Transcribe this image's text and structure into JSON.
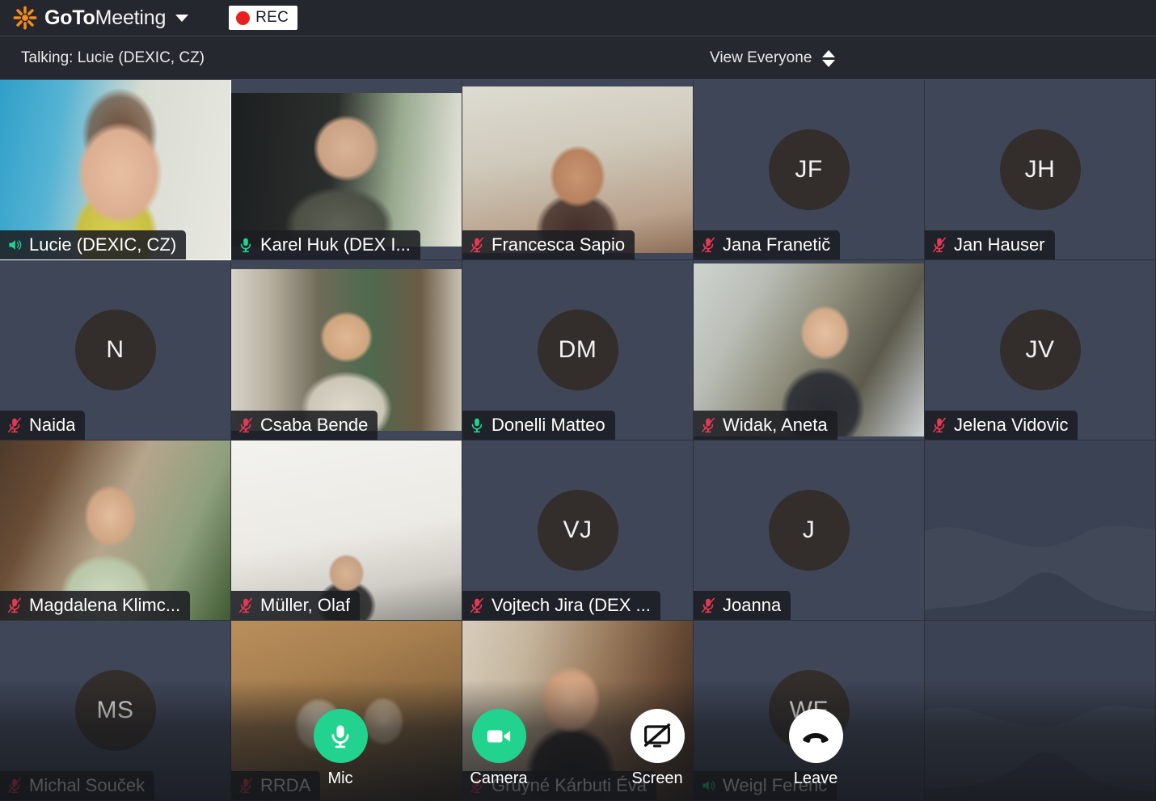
{
  "app": {
    "brand_bold": "GoTo",
    "brand_light": "Meeting",
    "recording_label": "REC"
  },
  "statusbar": {
    "talking": "Talking: Lucie (DEXIC, CZ)",
    "view_mode": "View Everyone"
  },
  "colors": {
    "accent_green": "#22d28f",
    "muted_red": "#e23a54",
    "rec_red": "#e8201f",
    "brand_orange": "#f68b1f",
    "tile_bg": "#3e4658",
    "avatar_bg": "#332e2b",
    "header_bg": "#24272d"
  },
  "participants": [
    {
      "name": "Lucie (DEXIC, CZ)",
      "audio": "speaker",
      "video": true,
      "active": true,
      "initials": "",
      "scene": "lucie"
    },
    {
      "name": "Karel Huk (DEX I...",
      "audio": "unmuted",
      "video": true,
      "active": false,
      "initials": "",
      "scene": "karel"
    },
    {
      "name": "Francesca Sapio",
      "audio": "muted",
      "video": true,
      "active": false,
      "initials": "",
      "scene": "francesca"
    },
    {
      "name": "Jana Franetič",
      "audio": "muted",
      "video": false,
      "active": false,
      "initials": "JF",
      "scene": ""
    },
    {
      "name": "Jan Hauser",
      "audio": "muted",
      "video": false,
      "active": false,
      "initials": "JH",
      "scene": ""
    },
    {
      "name": "Naida",
      "audio": "muted",
      "video": false,
      "active": false,
      "initials": "N",
      "scene": ""
    },
    {
      "name": "Csaba Bende",
      "audio": "muted",
      "video": true,
      "active": false,
      "initials": "",
      "scene": "csaba"
    },
    {
      "name": "Donelli Matteo",
      "audio": "unmuted",
      "video": false,
      "active": false,
      "initials": "DM",
      "scene": ""
    },
    {
      "name": "Widak, Aneta",
      "audio": "muted",
      "video": true,
      "active": false,
      "initials": "",
      "scene": "aneta"
    },
    {
      "name": "Jelena Vidovic",
      "audio": "muted",
      "video": false,
      "active": false,
      "initials": "JV",
      "scene": ""
    },
    {
      "name": "Magdalena Klimc...",
      "audio": "muted",
      "video": true,
      "active": false,
      "initials": "",
      "scene": "magdalena"
    },
    {
      "name": "Müller, Olaf",
      "audio": "muted",
      "video": true,
      "active": false,
      "initials": "",
      "scene": "olaf"
    },
    {
      "name": "Vojtech Jira (DEX ...",
      "audio": "muted",
      "video": false,
      "active": false,
      "initials": "VJ",
      "scene": ""
    },
    {
      "name": "Joanna",
      "audio": "muted",
      "video": false,
      "active": false,
      "initials": "J",
      "scene": ""
    },
    {
      "name": "",
      "audio": "",
      "video": false,
      "active": false,
      "initials": "",
      "scene": "empty"
    },
    {
      "name": "Michal Souček",
      "audio": "muted",
      "video": false,
      "active": false,
      "initials": "MS",
      "scene": ""
    },
    {
      "name": "RRDA",
      "audio": "muted",
      "video": true,
      "active": false,
      "initials": "",
      "scene": "rrda"
    },
    {
      "name": "Gruyné Kárbuti Éva",
      "audio": "muted",
      "video": true,
      "active": false,
      "initials": "",
      "scene": "eva"
    },
    {
      "name": "Weigl Ferenc",
      "audio": "speaker",
      "video": false,
      "active": false,
      "initials": "WF",
      "scene": ""
    },
    {
      "name": "",
      "audio": "",
      "video": false,
      "active": false,
      "initials": "",
      "scene": "empty"
    }
  ],
  "controls": [
    {
      "id": "mic",
      "label": "Mic",
      "style": "green",
      "icon": "microphone-icon"
    },
    {
      "id": "camera",
      "label": "Camera",
      "style": "green",
      "icon": "video-camera-icon"
    },
    {
      "id": "screen",
      "label": "Screen",
      "style": "white",
      "icon": "screen-share-off-icon"
    },
    {
      "id": "leave",
      "label": "Leave",
      "style": "white",
      "icon": "phone-hangup-icon"
    }
  ]
}
